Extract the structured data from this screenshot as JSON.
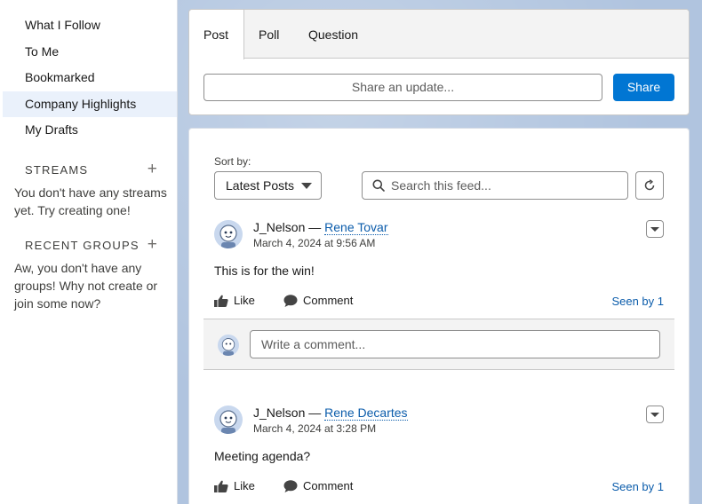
{
  "sidebar": {
    "items": [
      {
        "label": "What I Follow"
      },
      {
        "label": "To Me"
      },
      {
        "label": "Bookmarked"
      },
      {
        "label": "Company Highlights"
      },
      {
        "label": "My Drafts"
      }
    ],
    "streams": {
      "title": "STREAMS",
      "empty_text": "You don't have any streams yet. Try creating one!"
    },
    "groups": {
      "title": "RECENT GROUPS",
      "empty_text": "Aw, you don't have any groups! Why not create or join some now?"
    },
    "add_symbol": "+"
  },
  "publisher": {
    "tabs": [
      "Post",
      "Poll",
      "Question"
    ],
    "share_placeholder": "Share an update...",
    "share_label": "Share"
  },
  "feed": {
    "sort_label": "Sort by:",
    "sort_value": "Latest Posts",
    "search_placeholder": "Search this feed...",
    "posts": [
      {
        "author": "J_Nelson",
        "separator": " — ",
        "target": "Rene Tovar",
        "timestamp": "March 4, 2024 at 9:56 AM",
        "body": "This is for the win!",
        "like_label": "Like",
        "comment_label": "Comment",
        "seen_label": "Seen by 1",
        "comment_placeholder": "Write a comment..."
      },
      {
        "author": "J_Nelson",
        "separator": " — ",
        "target": "Rene Decartes",
        "timestamp": "March 4, 2024 at 3:28 PM",
        "body": "Meeting agenda?",
        "like_label": "Like",
        "comment_label": "Comment",
        "seen_label": "Seen by 1"
      }
    ]
  },
  "colors": {
    "brand": "#0176d3",
    "link": "#0b5cab",
    "active_nav": "#eaf1fb",
    "background": "#b0c4df"
  }
}
